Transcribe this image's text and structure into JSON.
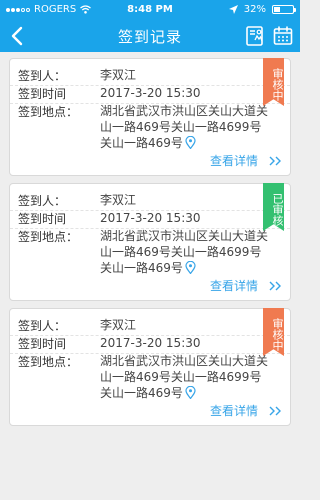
{
  "status_bar": {
    "carrier": "ROGERS",
    "time": "8:48 PM",
    "battery": "32%",
    "battery_level": 0.32
  },
  "header": {
    "title": "签到记录",
    "back_icon": "back-arrow-icon",
    "icons": [
      "map-list-icon",
      "calendar-icon"
    ]
  },
  "labels": {
    "person": "签到人：",
    "time": "签到时间",
    "location": "签到地点："
  },
  "records": [
    {
      "person": "李双江",
      "time": "2017-3-20 15:30",
      "location": "湖北省武汉市洪山区关山大道关山一路469号关山一路4699号关山一路469号",
      "status": "审核中",
      "status_color": "#f07a50",
      "detail": "查看详情"
    },
    {
      "person": "李双江",
      "time": "2017-3-20 15:30",
      "location": "湖北省武汉市洪山区关山大道关山一路469号关山一路4699号关山一路469号",
      "status": "已审核",
      "status_color": "#33c070",
      "detail": "查看详情"
    },
    {
      "person": "李双江",
      "time": "2017-3-20 15:30",
      "location": "湖北省武汉市洪山区关山大道关山一路469号关山一路4699号关山一路469号",
      "status": "审核中",
      "status_color": "#f07a50",
      "detail": "查看详情"
    }
  ]
}
